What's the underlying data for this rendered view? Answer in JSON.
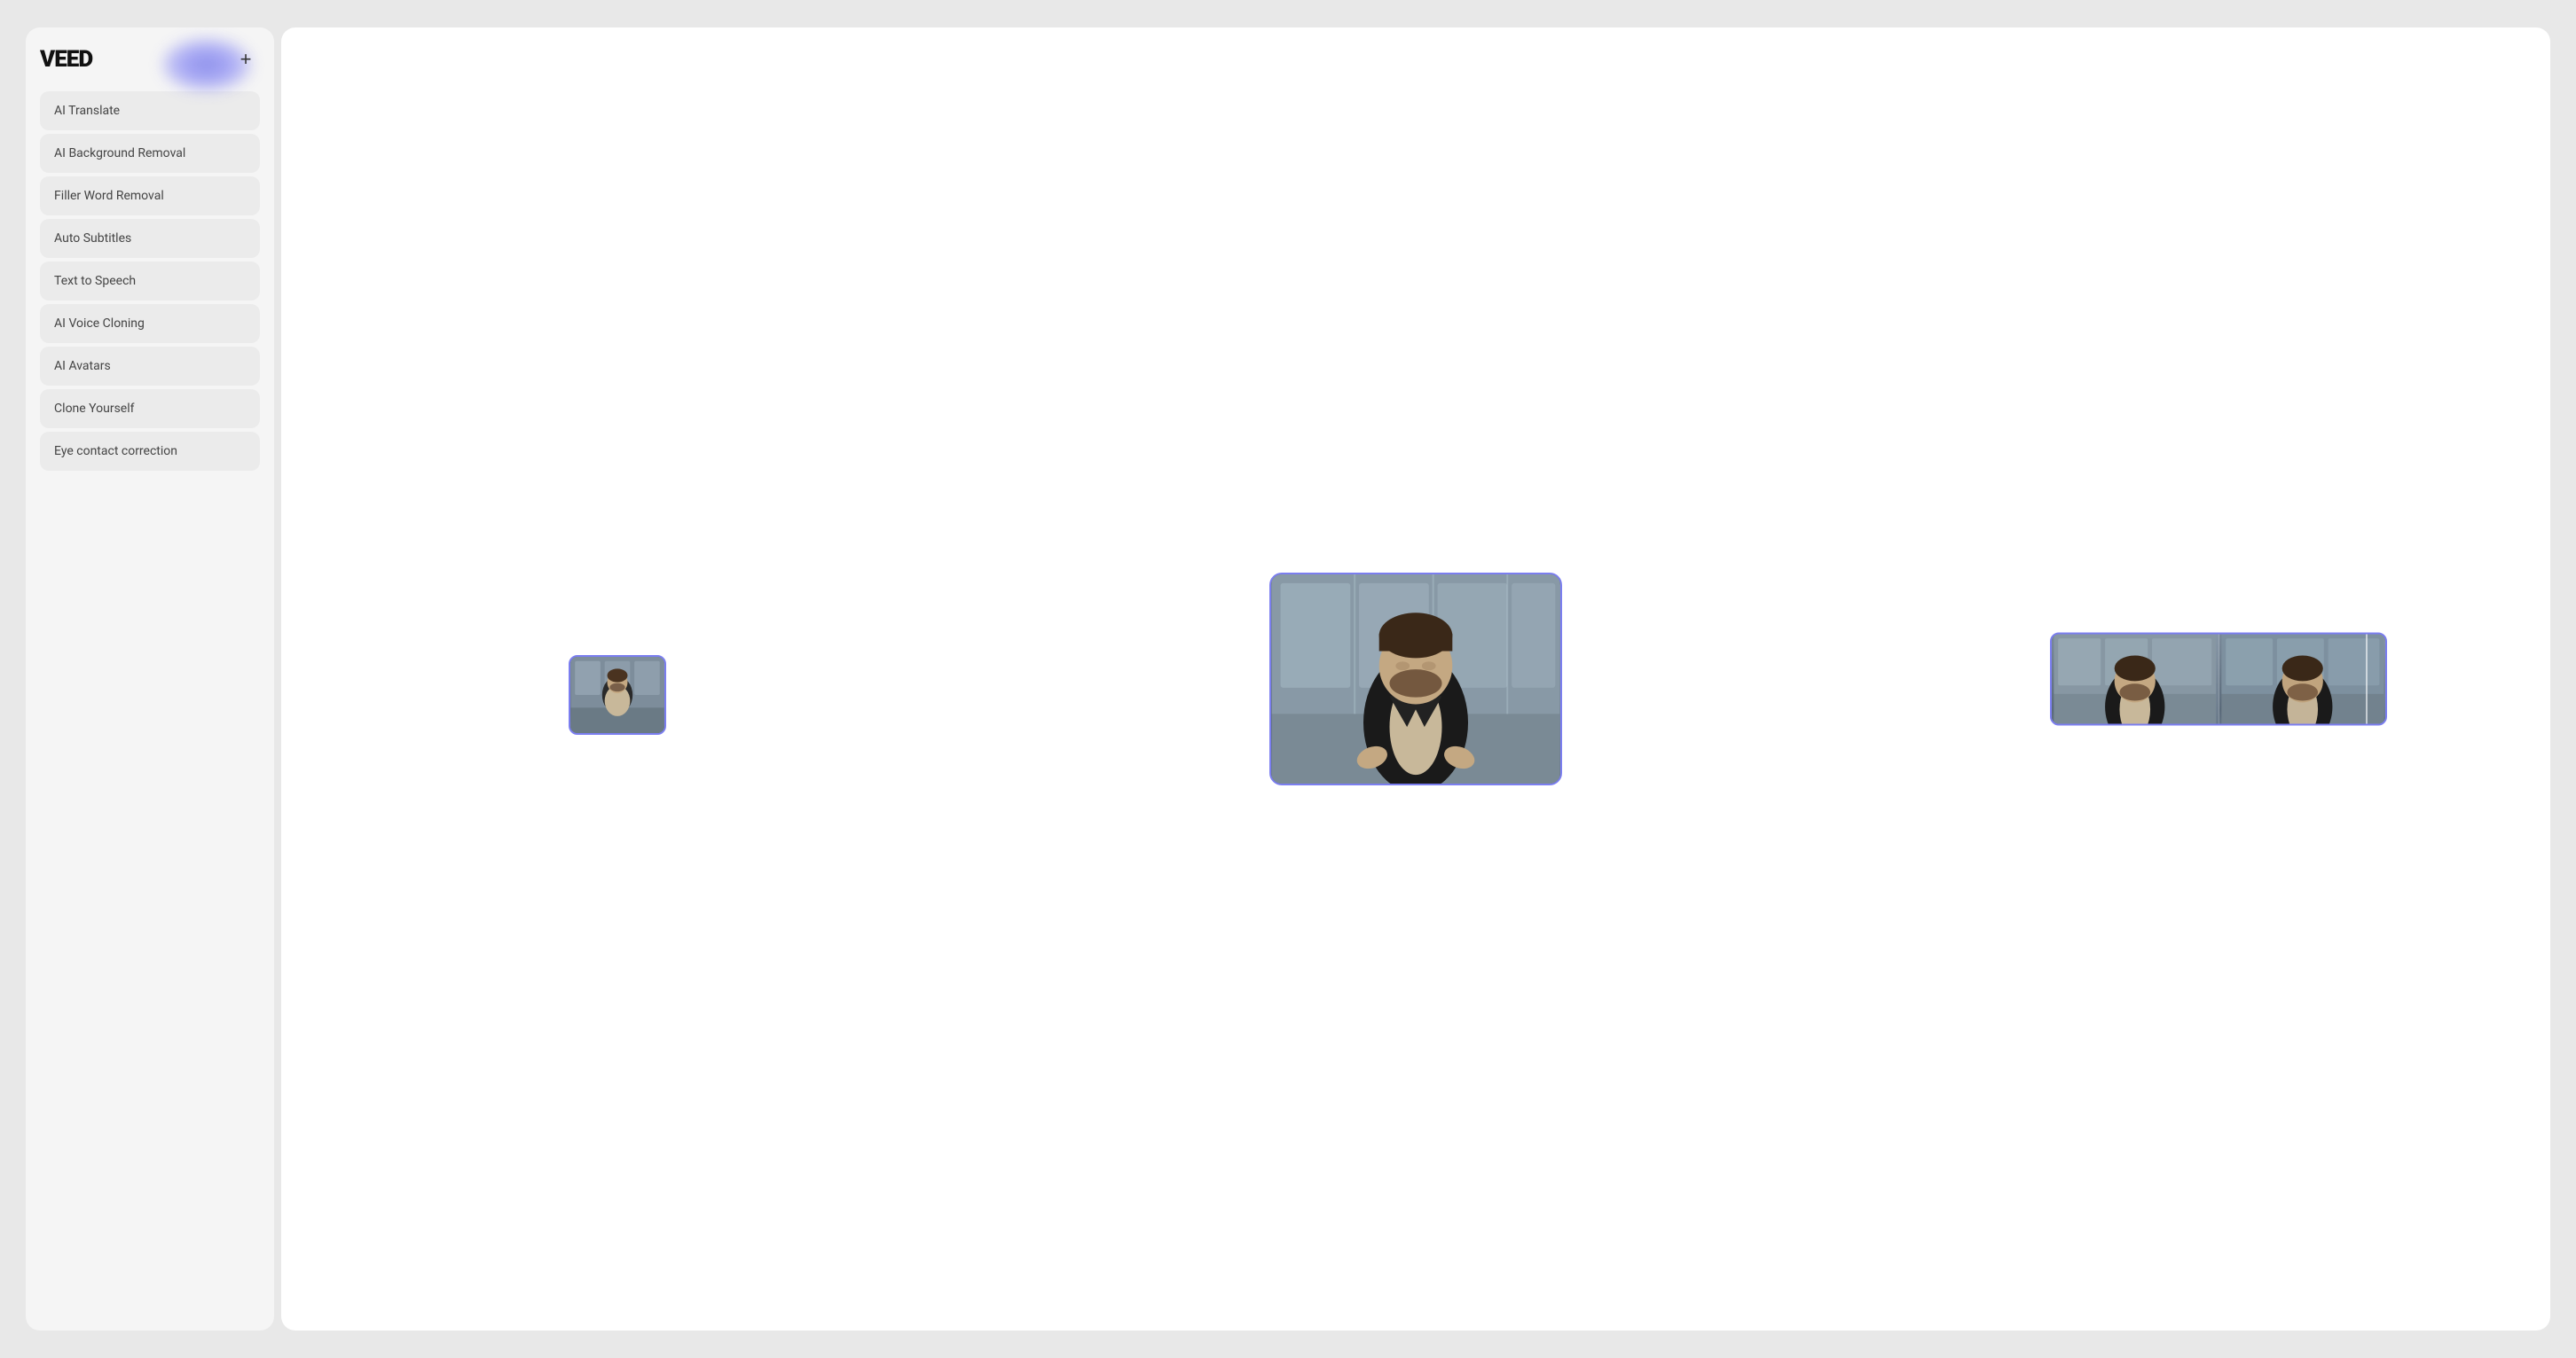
{
  "app": {
    "logo": "VEED",
    "plus_label": "+"
  },
  "sidebar": {
    "items": [
      {
        "id": "ai-translate",
        "label": "AI Translate"
      },
      {
        "id": "ai-background-removal",
        "label": "AI Background Removal"
      },
      {
        "id": "filler-word-removal",
        "label": "Filler Word Removal"
      },
      {
        "id": "auto-subtitles",
        "label": "Auto Subtitles"
      },
      {
        "id": "text-to-speech",
        "label": "Text to Speech"
      },
      {
        "id": "ai-voice-cloning",
        "label": "AI Voice Cloning"
      },
      {
        "id": "ai-avatars",
        "label": "AI Avatars"
      },
      {
        "id": "clone-yourself",
        "label": "Clone Yourself"
      },
      {
        "id": "eye-contact-correction",
        "label": "Eye contact correction"
      }
    ]
  },
  "colors": {
    "accent": "#7b7ef0",
    "blob": "#8486f0"
  }
}
